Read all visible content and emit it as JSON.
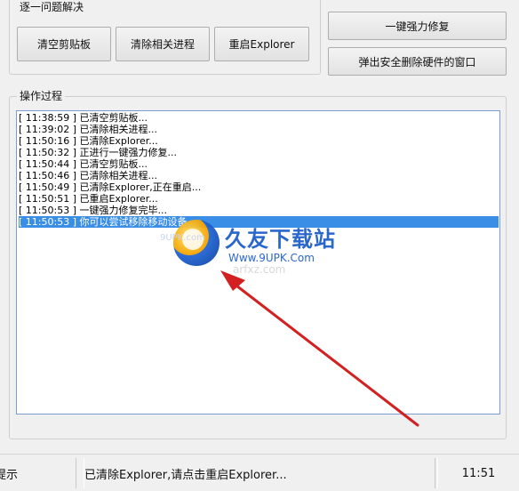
{
  "top_group": {
    "legend": "逐一问题解决",
    "buttons": {
      "clear_clipboard": "清空剪贴板",
      "kill_process": "清除相关进程",
      "restart_explorer": "重启Explorer"
    }
  },
  "side_buttons": {
    "one_click_repair": "一键强力修复",
    "eject_hardware": "弹出安全删除硬件的窗口"
  },
  "process_group": {
    "legend": "操作过程",
    "log_lines": [
      "[ 11:38:59 ] 已清空剪贴板...",
      "[ 11:39:02 ] 已清除相关进程...",
      "[ 11:50:16 ] 已清除Explorer...",
      "[ 11:50:32 ] 正进行一键强力修复...",
      "[ 11:50:44 ] 已清空剪贴板...",
      "[ 11:50:46 ] 已清除相关进程...",
      "[ 11:50:49 ] 已清除Explorer,正在重启...",
      "[ 11:50:51 ] 已重启Explorer...",
      "[ 11:50:53 ] 一键强力修复完毕...",
      "[ 11:50:53 ] 你可以尝试移除移动设备..."
    ],
    "selected_index": 9
  },
  "watermark": {
    "title": "久友下载站",
    "url": "Www.9UPK.Com",
    "ghost_text": "arfxz.com",
    "ghost_text2": "9UPK.com"
  },
  "statusbar": {
    "left": "提示",
    "message": "已清除Explorer,请点击重启Explorer...",
    "time": "11:51"
  },
  "colors": {
    "selection": "#3a8ee6",
    "arrow": "#d32020",
    "watermark_blue": "#1f5fc8"
  }
}
